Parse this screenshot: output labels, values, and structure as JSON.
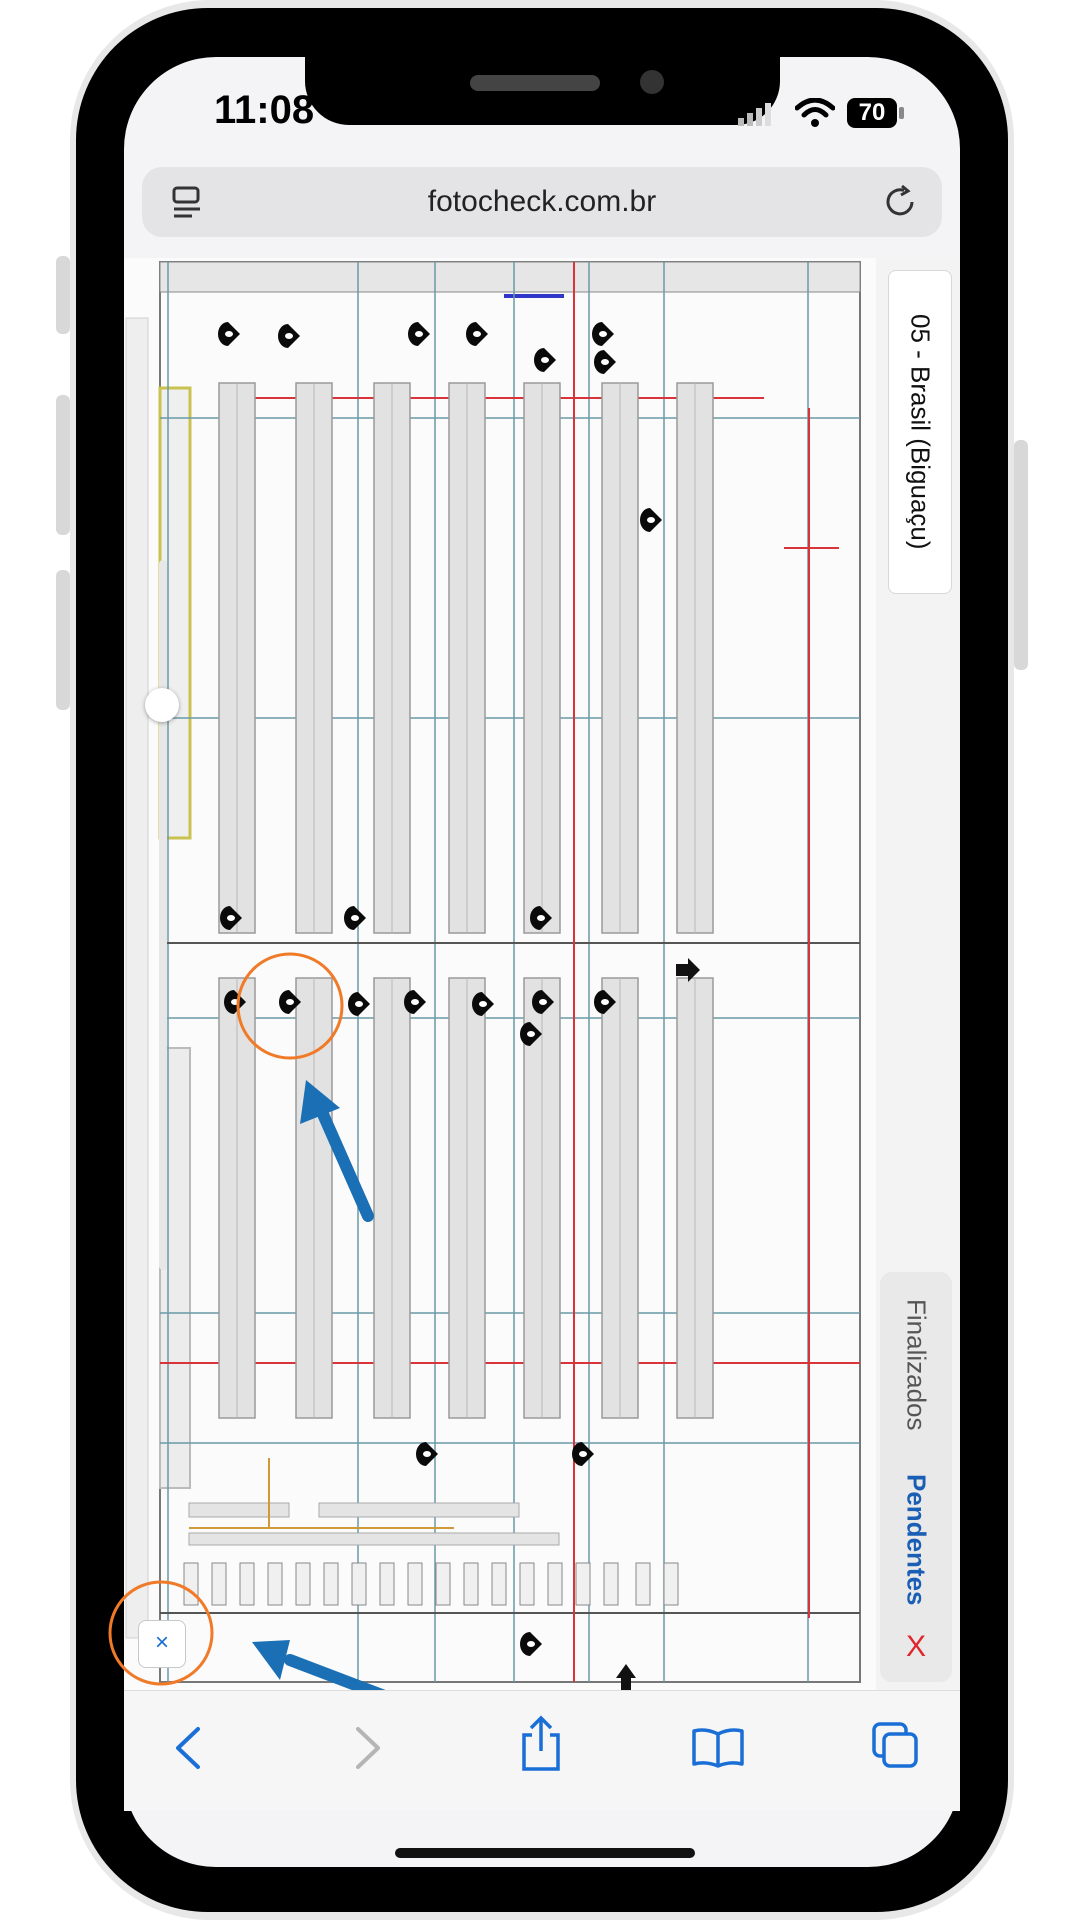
{
  "status_bar": {
    "time": "11:08",
    "battery": "70"
  },
  "browser": {
    "url": "fotocheck.com.br"
  },
  "map_panel": {
    "region_label": "05 - Brasil (Biguaçu)",
    "tabs": [
      {
        "label": "Finalizados",
        "active": false
      },
      {
        "label": "Pendentes",
        "active": true
      }
    ],
    "close_label": "X"
  },
  "zoom_slider": {
    "level": 0.73
  },
  "map_close_button": {
    "label": "×"
  },
  "icons": [
    "reader-mode-icon",
    "reload-icon",
    "back-icon",
    "forward-icon",
    "share-icon",
    "bookmarks-icon",
    "tabs-icon",
    "map-pin-icon",
    "wifi-icon",
    "signal-icon",
    "battery-icon"
  ],
  "colors": {
    "accent": "#1a5fb4",
    "annotation_circle": "#f07a27",
    "annotation_arrow": "#1b6fb5",
    "close_red": "#e0262b"
  }
}
